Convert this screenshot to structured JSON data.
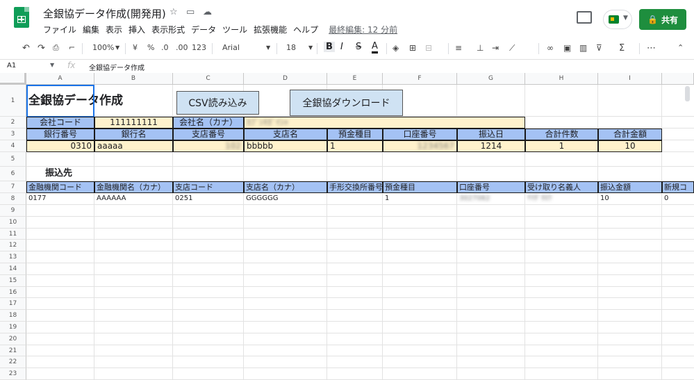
{
  "app": {
    "title": "全銀協データ作成(開発用)",
    "share_label": "共有",
    "last_edit": "最終編集: 12 分前",
    "menu": [
      "ファイル",
      "編集",
      "表示",
      "挿入",
      "表示形式",
      "データ",
      "ツール",
      "拡張機能",
      "ヘルプ"
    ]
  },
  "toolbar": {
    "zoom": "100%",
    "currency": "¥",
    "percent": "%",
    "dec_less": ".0",
    "dec_more": ".00",
    "format": "123",
    "font": "Arial",
    "size": "18",
    "bold": "B",
    "italic": "I",
    "strike": "S",
    "textcolor": "A",
    "sum": "Σ",
    "more": "⋯"
  },
  "formula": {
    "cell": "A1",
    "fx": "fx",
    "value": "全銀協データ作成"
  },
  "columns": [
    "A",
    "B",
    "C",
    "D",
    "E",
    "F",
    "G",
    "H",
    "I"
  ],
  "rows": [
    "1",
    "2",
    "3",
    "4",
    "5",
    "6",
    "7",
    "8",
    "9",
    "10",
    "11",
    "12",
    "13",
    "14",
    "15",
    "16",
    "17",
    "18",
    "19",
    "20",
    "21",
    "22",
    "23"
  ],
  "sheet": {
    "title": "全銀協データ作成",
    "csv_button": "CSV読み込み",
    "download_button": "全銀協ダウンロード",
    "company_code_label": "会社コード",
    "company_code": "111111111",
    "company_name_label": "会社名（カナ）",
    "company_name": "ｶﾌﾞｼｷｶﾞｲｼｬ",
    "header3": [
      "銀行番号",
      "銀行名",
      "支店番号",
      "支店名",
      "預金種目",
      "口座番号",
      "振込日",
      "合計件数",
      "合計金額"
    ],
    "row4": [
      "0310",
      "aaaaa",
      "102",
      "bbbbb",
      "1",
      "1234567",
      "1214",
      "1",
      "10"
    ],
    "section": "振込先",
    "header7": [
      "金融機関コード",
      "金融機関名（カナ）",
      "支店コード",
      "支店名（カナ）",
      "手形交換所番号",
      "預金種目",
      "口座番号",
      "受け取り名義人",
      "振込金額",
      "新規コ"
    ],
    "row8": [
      "0177",
      "AAAAAA",
      "0251",
      "GGGGGG",
      "",
      "1",
      "3027062",
      "ﾔﾏﾀﾞﾀﾛｳ",
      "10",
      "0"
    ]
  },
  "colors": {
    "header_blue": "#a4c2f4",
    "cream": "#fff2cc",
    "share_green": "#1e8e3e",
    "select_blue": "#1a73e8"
  }
}
